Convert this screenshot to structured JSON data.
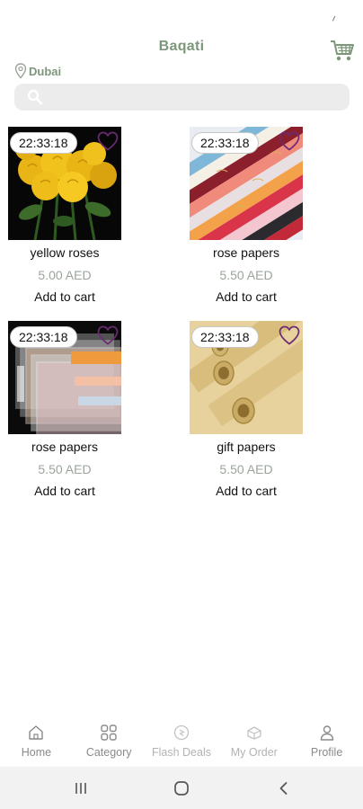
{
  "app": {
    "title": "Baqati"
  },
  "location": {
    "label": "Dubai"
  },
  "search": {
    "placeholder": "",
    "value": ""
  },
  "products": [
    {
      "name": "yellow roses",
      "price": "5.00 AED",
      "timer": "22:33:18",
      "add_label": "Add to cart",
      "image": "yellow-roses-photo"
    },
    {
      "name": "rose papers",
      "price": "5.50 AED",
      "timer": "22:33:18",
      "add_label": "Add to cart",
      "image": "colored-wrapping-papers-photo"
    },
    {
      "name": "rose papers",
      "price": "5.50 AED",
      "timer": "22:33:18",
      "add_label": "Add to cart",
      "image": "translucent-wrapping-sheets-photo"
    },
    {
      "name": "gift papers",
      "price": "5.50 AED",
      "timer": "22:33:18",
      "add_label": "Add to cart",
      "image": "kraft-paper-rolls-photo"
    }
  ],
  "nav": {
    "items": [
      {
        "label": "Home",
        "icon": "home-icon"
      },
      {
        "label": "Category",
        "icon": "grid-icon"
      },
      {
        "label": "Flash Deals",
        "icon": "flash-deals-icon"
      },
      {
        "label": "My Order",
        "icon": "order-icon"
      },
      {
        "label": "Profile",
        "icon": "profile-icon"
      }
    ]
  },
  "system_nav": {
    "icons": [
      "recent-apps-icon",
      "home-circle-icon",
      "back-icon"
    ]
  },
  "colors": {
    "brand": "#7d977b",
    "heart": "#6b2a72",
    "price": "#9aa69a",
    "search_bg": "#ececec"
  }
}
